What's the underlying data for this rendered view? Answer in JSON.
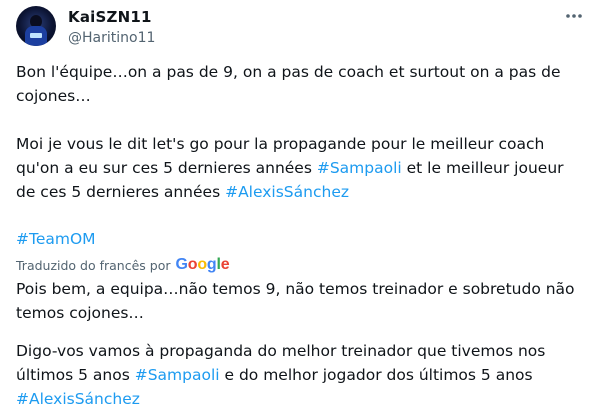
{
  "author": {
    "name": "KaiSZN11",
    "handle": "@Haritino11"
  },
  "original": {
    "para1": "Bon l'équipe…on a pas de 9, on a pas de coach et surtout on a pas de cojones…",
    "para2_text": "Moi je vous le dit let's go pour la propagande pour le meilleur coach qu'on a eu sur ces 5 dernieres années ",
    "para2_tag1": "#Sampaoli",
    "para2_mid": " et le meilleur joueur de ces 5 dernieres années ",
    "para2_tag2": "#AlexisSánchez",
    "hashtag": "#TeamOM"
  },
  "translation": {
    "label": "Traduzido do francês por",
    "provider": "Google",
    "para1": "Pois bem, a equipa…não temos 9, não temos treinador e sobretudo não temos cojones…",
    "para2_text": "Digo-vos vamos à propaganda do melhor treinador que tivemos nos últimos 5 anos ",
    "para2_tag1": "#Sampaoli",
    "para2_mid": " e do melhor jogador dos últimos 5 anos ",
    "para2_tag2": "#AlexisSánchez"
  },
  "icons": {
    "more": "more-options-icon"
  },
  "colors": {
    "link": "#1d9bf0",
    "secondary_text": "#536471",
    "text": "#0f1419"
  }
}
